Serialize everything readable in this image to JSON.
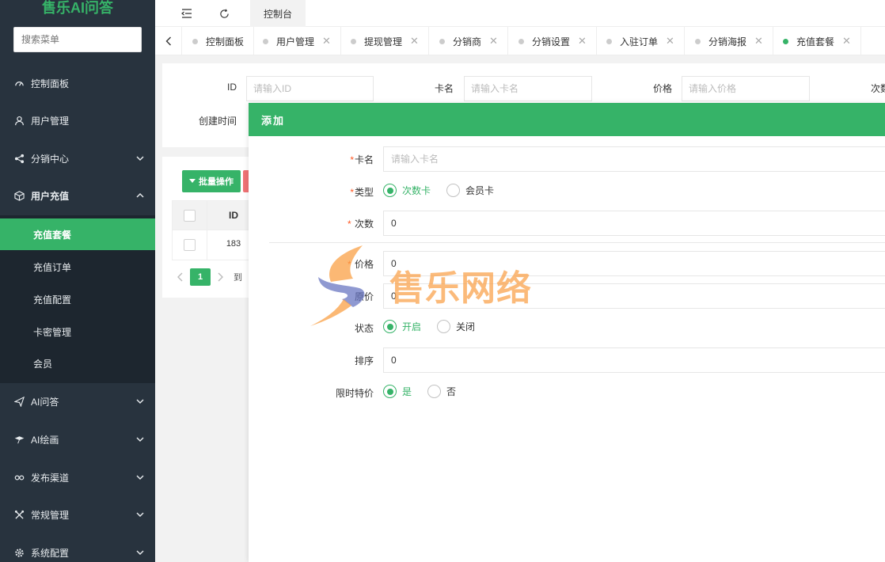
{
  "sidebar": {
    "logo": "售乐AI问答",
    "search_placeholder": "搜索菜单",
    "menu": [
      {
        "label": "控制面板",
        "icon": "dashboard-icon"
      },
      {
        "label": "用户管理",
        "icon": "user-icon"
      },
      {
        "label": "分销中心",
        "icon": "share-icon"
      },
      {
        "label": "用户充值",
        "icon": "cube-icon"
      },
      {
        "label": "AI问答",
        "icon": "send-icon"
      },
      {
        "label": "AI绘画",
        "icon": "brush-icon"
      },
      {
        "label": "发布渠道",
        "icon": "link-icon"
      },
      {
        "label": "常规管理",
        "icon": "tools-icon"
      },
      {
        "label": "系统配置",
        "icon": "gear-icon"
      }
    ],
    "submenu": [
      {
        "label": "充值套餐",
        "active": true
      },
      {
        "label": "充值订单"
      },
      {
        "label": "充值配置"
      },
      {
        "label": "卡密管理"
      },
      {
        "label": "会员"
      }
    ]
  },
  "header": {
    "tab_label": "控制台"
  },
  "tabs": [
    {
      "label": "控制面板"
    },
    {
      "label": "用户管理"
    },
    {
      "label": "提现管理"
    },
    {
      "label": "分销商"
    },
    {
      "label": "分销设置"
    },
    {
      "label": "入驻订单"
    },
    {
      "label": "分销海报"
    },
    {
      "label": "充值套餐",
      "active": true
    }
  ],
  "tab_close": "✕",
  "filters": {
    "id_label": "ID",
    "id_placeholder": "请输入ID",
    "name_label": "卡名",
    "name_placeholder": "请输入卡名",
    "price_label": "价格",
    "price_placeholder": "请输入价格",
    "count_label": "次数",
    "created_label": "创建时间"
  },
  "table": {
    "batch_button": "批量操作",
    "header_id": "ID",
    "rows": [
      {
        "id": "183"
      }
    ],
    "page": "1",
    "pager_text": "到"
  },
  "modal": {
    "title": "添加",
    "fields": {
      "card_name_label": "卡名",
      "card_name_placeholder": "请输入卡名",
      "type_label": "类型",
      "type_options": [
        "次数卡",
        "会员卡"
      ],
      "count_label": "次数",
      "count_value": "0",
      "price_label": "价格",
      "price_value": "0",
      "original_label": "原价",
      "original_value": "0",
      "status_label": "状态",
      "status_options": [
        "开启",
        "关闭"
      ],
      "sort_label": "排序",
      "sort_value": "0",
      "limited_label": "限时特价",
      "limited_options": [
        "是",
        "否"
      ]
    }
  },
  "watermark": "售乐网络",
  "colors": {
    "accent": "#36b368",
    "sidebar": "#28333e",
    "danger": "#f07274"
  }
}
